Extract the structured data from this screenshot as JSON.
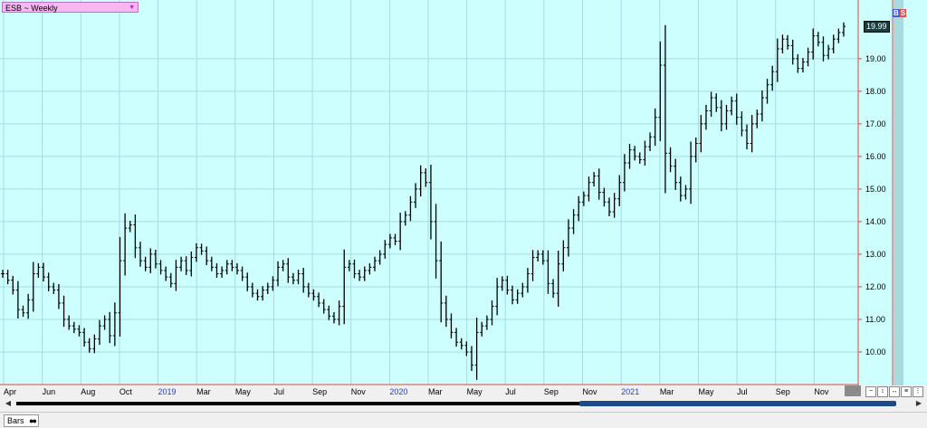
{
  "symbol": {
    "label": "ESB ~ Weekly",
    "dropdown_icon": "triangle-down-icon"
  },
  "markers": {
    "b": "B",
    "s": "S"
  },
  "last_price": "19.99",
  "colors": {
    "plot_bg": "#ccfffe",
    "grid": "#a8dbe0",
    "bar": "#000000",
    "axis_line": "#e8463c",
    "year_label": "#1f3fd8"
  },
  "bottom": {
    "tab_label": "Bars"
  },
  "chart_data": {
    "type": "ohlc",
    "title": "ESB ~ Weekly",
    "yticks": [
      "10.00",
      "11.00",
      "12.00",
      "13.00",
      "14.00",
      "15.00",
      "16.00",
      "17.00",
      "18.00",
      "19.00"
    ],
    "ylim": [
      9.0,
      20.8
    ],
    "grid": true,
    "x_tick_labels": [
      {
        "label": "Apr",
        "year": false
      },
      {
        "label": "Jun",
        "year": false
      },
      {
        "label": "Aug",
        "year": false
      },
      {
        "label": "Oct",
        "year": false
      },
      {
        "label": "2019",
        "year": true
      },
      {
        "label": "Mar",
        "year": false
      },
      {
        "label": "May",
        "year": false
      },
      {
        "label": "Jul",
        "year": false
      },
      {
        "label": "Sep",
        "year": false
      },
      {
        "label": "Nov",
        "year": false
      },
      {
        "label": "2020",
        "year": true
      },
      {
        "label": "Mar",
        "year": false
      },
      {
        "label": "May",
        "year": false
      },
      {
        "label": "Jul",
        "year": false
      },
      {
        "label": "Sep",
        "year": false
      },
      {
        "label": "Nov",
        "year": false
      },
      {
        "label": "2021",
        "year": true
      },
      {
        "label": "Mar",
        "year": false
      },
      {
        "label": "May",
        "year": false
      },
      {
        "label": "Jul",
        "year": false
      },
      {
        "label": "Sep",
        "year": false
      },
      {
        "label": "Nov",
        "year": false
      }
    ],
    "closes": [
      12.4,
      12.2,
      11.9,
      11.3,
      11.2,
      11.6,
      12.4,
      12.6,
      12.3,
      12.0,
      11.9,
      11.5,
      11.0,
      10.8,
      10.7,
      10.6,
      10.3,
      10.1,
      10.4,
      10.8,
      11.0,
      10.5,
      11.2,
      12.8,
      13.8,
      13.9,
      13.2,
      12.8,
      12.6,
      13.0,
      12.7,
      12.5,
      12.3,
      12.1,
      12.6,
      12.8,
      12.5,
      12.9,
      13.2,
      13.1,
      12.8,
      12.6,
      12.4,
      12.5,
      12.7,
      12.6,
      12.5,
      12.3,
      12.0,
      11.8,
      11.7,
      11.9,
      12.0,
      12.2,
      12.6,
      12.7,
      12.3,
      12.2,
      12.4,
      12.0,
      11.8,
      11.7,
      11.5,
      11.3,
      11.1,
      11.0,
      11.4,
      12.6,
      12.7,
      12.4,
      12.3,
      12.5,
      12.6,
      12.8,
      13.0,
      13.3,
      13.5,
      13.4,
      14.0,
      14.2,
      14.6,
      15.0,
      15.5,
      15.2,
      14.0,
      12.8,
      11.5,
      11.0,
      10.6,
      10.3,
      10.2,
      10.0,
      9.6,
      10.6,
      10.8,
      11.0,
      11.4,
      12.0,
      12.2,
      11.9,
      11.6,
      11.8,
      12.0,
      12.4,
      12.9,
      13.0,
      12.8,
      12.1,
      11.8,
      12.7,
      13.2,
      13.8,
      14.2,
      14.6,
      14.8,
      15.2,
      15.4,
      14.9,
      14.6,
      14.3,
      14.7,
      15.2,
      15.8,
      16.2,
      16.0,
      15.9,
      16.3,
      16.6,
      17.2,
      18.8,
      16.1,
      15.7,
      15.2,
      14.8,
      15.0,
      16.0,
      16.4,
      17.0,
      17.4,
      17.8,
      17.5,
      17.0,
      17.4,
      17.7,
      17.2,
      16.8,
      16.4,
      17.0,
      17.3,
      17.8,
      18.2,
      18.6,
      19.3,
      19.6,
      19.4,
      19.0,
      18.7,
      18.9,
      19.2,
      19.7,
      19.5,
      19.1,
      19.3,
      19.6,
      19.8,
      19.99
    ]
  }
}
